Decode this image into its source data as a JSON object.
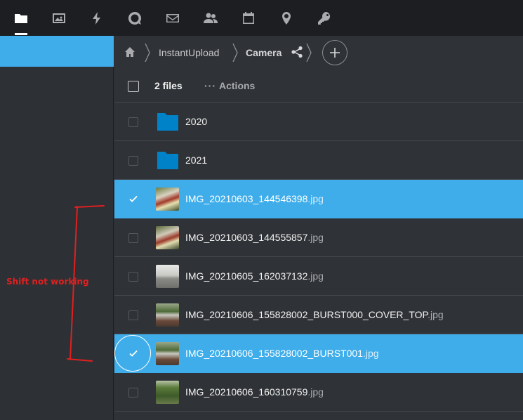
{
  "topbar": {
    "apps": [
      {
        "icon": "folder-icon",
        "active": true
      },
      {
        "icon": "image-icon"
      },
      {
        "icon": "activity-icon"
      },
      {
        "icon": "talk-icon"
      },
      {
        "icon": "mail-icon"
      },
      {
        "icon": "contacts-icon"
      },
      {
        "icon": "calendar-icon"
      },
      {
        "icon": "maps-icon"
      },
      {
        "icon": "passwords-icon"
      }
    ]
  },
  "breadcrumb": {
    "items": [
      "InstantUpload",
      "Camera"
    ]
  },
  "list_header": {
    "files_count": "2 files",
    "actions_dots": "···",
    "actions_label": "Actions"
  },
  "files": [
    {
      "name": "2020",
      "ext": "",
      "type": "folder",
      "selected": false
    },
    {
      "name": "2021",
      "ext": "",
      "type": "folder",
      "selected": false
    },
    {
      "name": "IMG_20210603_144546398",
      "ext": ".jpg",
      "type": "image",
      "selected": true
    },
    {
      "name": "IMG_20210603_144555857",
      "ext": ".jpg",
      "type": "image",
      "selected": false
    },
    {
      "name": "IMG_20210605_162037132",
      "ext": ".jpg",
      "type": "image",
      "selected": false
    },
    {
      "name": "IMG_20210606_155828002_BURST000_COVER_TOP",
      "ext": ".jpg",
      "type": "image",
      "selected": false
    },
    {
      "name": "IMG_20210606_155828002_BURST001",
      "ext": ".jpg",
      "type": "image",
      "selected": true
    },
    {
      "name": "IMG_20210606_160310759",
      "ext": ".jpg",
      "type": "image",
      "selected": false
    }
  ],
  "annotation": {
    "text": "Shift not working",
    "color": "#e02020"
  },
  "colors": {
    "accent": "#3fadea",
    "folder": "#0082c9"
  }
}
